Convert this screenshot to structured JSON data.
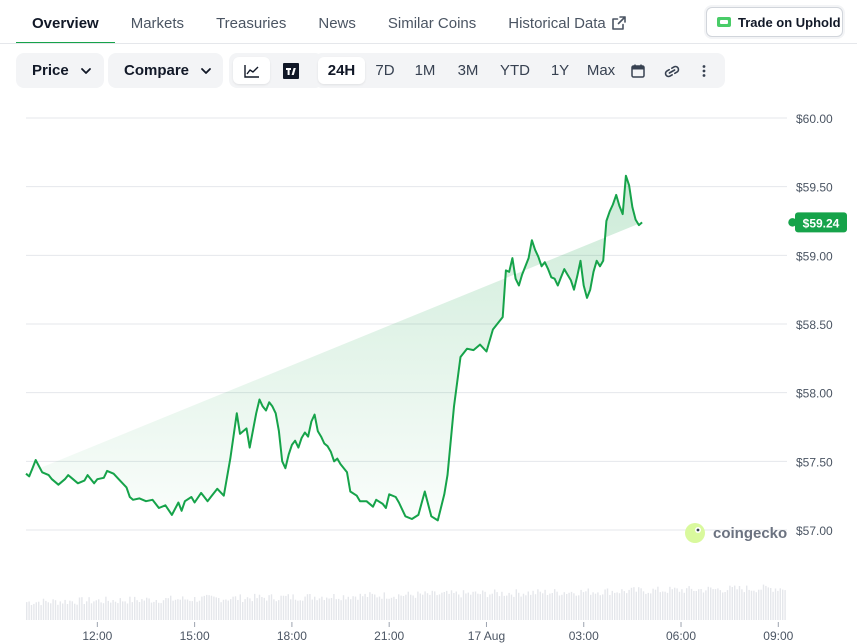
{
  "tabs": [
    {
      "label": "Overview",
      "active": true
    },
    {
      "label": "Markets"
    },
    {
      "label": "Treasuries"
    },
    {
      "label": "News"
    },
    {
      "label": "Similar Coins"
    },
    {
      "label": "Historical Data",
      "external": true
    }
  ],
  "trade_button": {
    "label": "Trade on Uphold"
  },
  "toolbar": {
    "price_label": "Price",
    "compare_label": "Compare",
    "ranges": [
      "24H",
      "7D",
      "1M",
      "3M",
      "YTD",
      "1Y",
      "Max"
    ],
    "active_range": "24H"
  },
  "watermark": "coingecko",
  "colors": {
    "accent": "#16a34a",
    "line": "#16a34a",
    "grid": "#e5e7eb"
  },
  "chart_data": {
    "type": "area",
    "y_ticks": [
      "$60.00",
      "$59.50",
      "$59.00",
      "$58.50",
      "$58.00",
      "$57.50",
      "$57.00"
    ],
    "y_tick_values": [
      60.0,
      59.5,
      59.0,
      58.5,
      58.0,
      57.5,
      57.0
    ],
    "ylim": [
      56.92,
      60.07
    ],
    "x_ticks": [
      "12:00",
      "15:00",
      "18:00",
      "21:00",
      "17 Aug",
      "03:00",
      "06:00",
      "09:00"
    ],
    "x_tick_hours": [
      12,
      15,
      18,
      21,
      24,
      27,
      30,
      33
    ],
    "xlim": [
      9.8,
      33.7
    ],
    "current_price_label": "$59.24",
    "current_price": 59.24,
    "series": [
      {
        "hours": [
          9.8,
          9.9,
          10.0,
          10.1,
          10.3,
          10.5,
          10.6,
          10.8,
          11.0,
          11.1,
          11.2,
          11.4,
          11.6,
          11.7,
          11.9,
          12.0,
          12.2,
          12.3,
          12.5,
          12.7,
          12.9,
          13.0,
          13.1,
          13.3,
          13.5,
          13.7,
          13.9,
          14.1,
          14.3,
          14.5,
          14.6,
          14.7,
          14.9,
          15.0,
          15.2,
          15.4,
          15.5,
          15.7,
          15.9,
          16.1,
          16.3,
          16.4,
          16.6,
          16.7,
          16.9,
          17.0,
          17.1,
          17.2,
          17.3,
          17.4,
          17.5,
          17.6,
          17.7,
          17.8,
          17.9,
          18.0,
          18.1,
          18.2,
          18.3,
          18.4,
          18.5,
          18.6,
          18.7,
          18.8,
          18.9,
          19.0,
          19.1,
          19.2,
          19.3,
          19.4,
          19.5,
          19.6,
          19.7,
          19.8,
          20.0,
          20.1,
          20.3,
          20.5,
          20.6,
          20.8,
          20.9,
          21.0,
          21.2,
          21.3,
          21.5,
          21.7,
          21.9,
          22.1,
          22.3,
          22.5,
          22.7,
          22.8,
          23.0,
          23.2,
          23.4,
          23.6,
          23.8,
          24.0,
          24.2,
          24.4,
          24.5,
          24.6,
          24.7,
          24.8,
          24.9,
          25.0,
          25.1,
          25.2,
          25.3,
          25.4,
          25.5,
          25.6,
          25.7,
          25.8,
          25.9,
          26.0,
          26.1,
          26.2,
          26.3,
          26.4,
          26.5,
          26.6,
          26.7,
          26.8,
          26.9,
          27.0,
          27.1,
          27.2,
          27.3,
          27.4,
          27.5,
          27.6,
          27.7,
          27.8,
          27.9,
          28.0,
          28.1,
          28.2,
          28.3,
          28.4,
          28.5,
          28.6,
          28.7,
          28.8,
          28.9,
          29.0,
          29.1,
          29.2,
          29.3,
          29.4,
          29.5,
          29.6,
          29.7,
          29.8,
          29.9,
          30.0,
          30.1,
          30.2,
          30.3,
          30.4,
          30.5,
          30.6,
          30.7,
          30.8,
          30.9,
          31.0,
          31.1,
          31.2,
          31.3,
          31.4,
          31.5,
          31.6,
          31.7,
          31.8,
          31.9,
          32.0,
          32.1,
          32.2,
          32.3,
          32.4,
          32.5,
          32.6,
          32.7,
          32.8,
          32.9,
          33.0,
          33.1,
          33.2,
          33.3,
          33.4,
          33.5
        ],
        "values": [
          57.41,
          57.39,
          57.45,
          57.51,
          57.42,
          57.4,
          57.37,
          57.33,
          57.37,
          57.4,
          57.38,
          57.34,
          57.36,
          57.4,
          57.34,
          57.37,
          57.38,
          57.43,
          57.41,
          57.36,
          57.31,
          57.24,
          57.22,
          57.23,
          57.21,
          57.22,
          57.16,
          57.18,
          57.11,
          57.2,
          57.14,
          57.21,
          57.24,
          57.2,
          57.27,
          57.21,
          57.24,
          57.3,
          57.25,
          57.52,
          57.85,
          57.7,
          57.74,
          57.6,
          57.85,
          57.95,
          57.9,
          57.87,
          57.93,
          57.9,
          57.85,
          57.72,
          57.5,
          57.45,
          57.55,
          57.62,
          57.65,
          57.6,
          57.67,
          57.71,
          57.68,
          57.79,
          57.84,
          57.72,
          57.68,
          57.63,
          57.61,
          57.57,
          57.5,
          57.52,
          57.48,
          57.45,
          57.42,
          57.28,
          57.25,
          57.21,
          57.21,
          57.17,
          57.22,
          57.19,
          57.16,
          57.26,
          57.24,
          57.2,
          57.1,
          57.08,
          57.11,
          57.28,
          57.1,
          57.07,
          57.26,
          57.4,
          57.9,
          58.26,
          58.32,
          58.31,
          58.35,
          58.3,
          58.46,
          58.52,
          58.55,
          58.89,
          58.88,
          58.98,
          58.83,
          58.78,
          58.86,
          58.92,
          58.98,
          59.11,
          59.04,
          58.99,
          58.92,
          58.95,
          58.9,
          58.84,
          58.83,
          58.78,
          58.84,
          58.9,
          58.86,
          58.82,
          58.75,
          58.85,
          58.96,
          58.78,
          58.69,
          58.75,
          58.88,
          58.96,
          58.92,
          58.96,
          59.25,
          59.32,
          59.37,
          59.44,
          59.36,
          59.3,
          59.58,
          59.51,
          59.35,
          59.26,
          59.22,
          59.24
        ],
        "hours_note": "",
        "volume_note": ""
      }
    ]
  }
}
